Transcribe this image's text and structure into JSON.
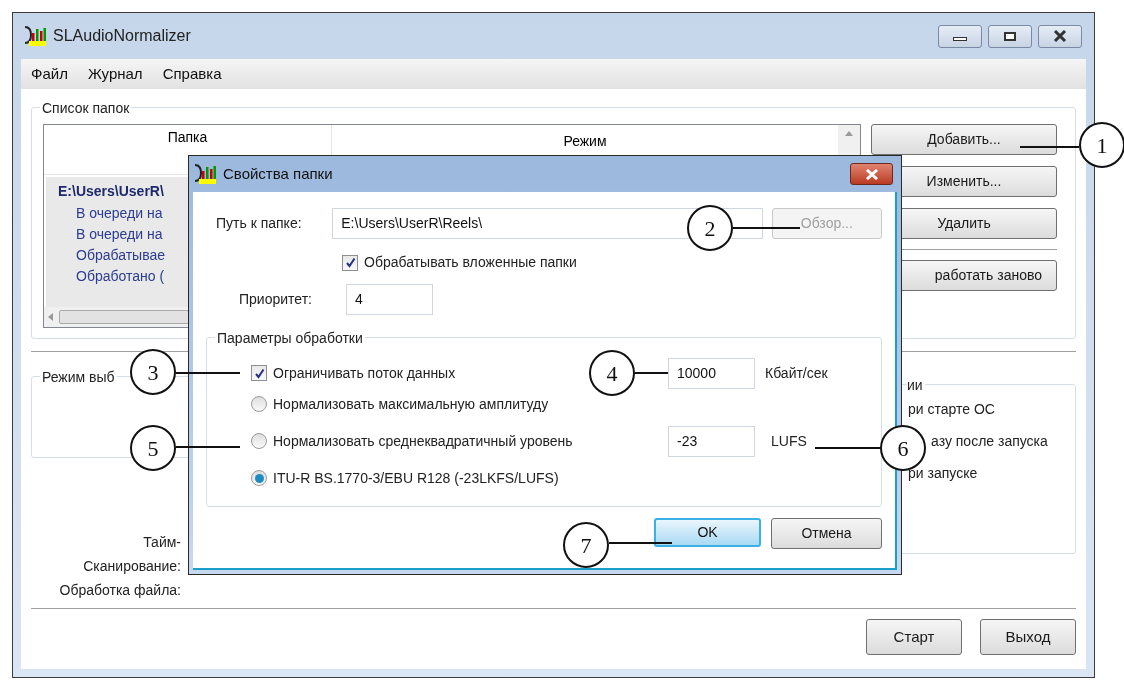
{
  "window": {
    "title": "SLAudioNormalizer"
  },
  "menu": [
    "Файл",
    "Журнал",
    "Справка"
  ],
  "folder_list": {
    "title": "Список папок",
    "columns": [
      "Папка",
      "Режим"
    ],
    "rows": [
      {
        "text": "E:\\Users\\UserR\\",
        "kind": "folder"
      },
      {
        "text": "В очереди на",
        "kind": "status"
      },
      {
        "text": "В очереди на",
        "kind": "status"
      },
      {
        "text": "Обрабатывае",
        "kind": "status"
      },
      {
        "text": "Обработано (",
        "kind": "status"
      }
    ],
    "buttons": [
      "Добавить...",
      "Изменить...",
      "Удалить",
      "работать заново"
    ]
  },
  "mode_group": {
    "title": "Режим выб"
  },
  "startup_group": {
    "title": "ии",
    "items": [
      "ри старте ОС",
      "азу после запуска",
      "ри запуске"
    ]
  },
  "status_labels": [
    "Тайм-",
    "Сканирование:",
    "Обработка файла:"
  ],
  "buttons": [
    "Старт",
    "Выход"
  ],
  "dialog": {
    "title": "Свойства папки",
    "path_label": "Путь к папке:",
    "path": "E:\\Users\\UserR\\Reels\\",
    "browse": {
      "label": "Обзор...",
      "disabled": true
    },
    "subfolders": {
      "label": "Обрабатывать вложенные папки",
      "checked": true
    },
    "priority_label": "Приоритет:",
    "priority": "4",
    "params": {
      "title": "Параметры обработки",
      "limit": {
        "label": "Ограничивать поток данных",
        "checked": true,
        "value": "10000",
        "unit": "Кбайт/сек"
      },
      "modes": [
        {
          "label": "Нормализовать максимальную амплитуду",
          "selected": false
        },
        {
          "label": "Нормализовать среднеквадратичный уровень",
          "selected": false,
          "value": "-23",
          "unit": "LUFS"
        },
        {
          "label": "ITU-R BS.1770-3/EBU R128 (-23LKFS/LUFS)",
          "selected": true
        }
      ]
    },
    "ok": "OK",
    "cancel": "Отмена"
  },
  "callouts": [
    "1",
    "2",
    "3",
    "4",
    "5",
    "6",
    "7"
  ]
}
